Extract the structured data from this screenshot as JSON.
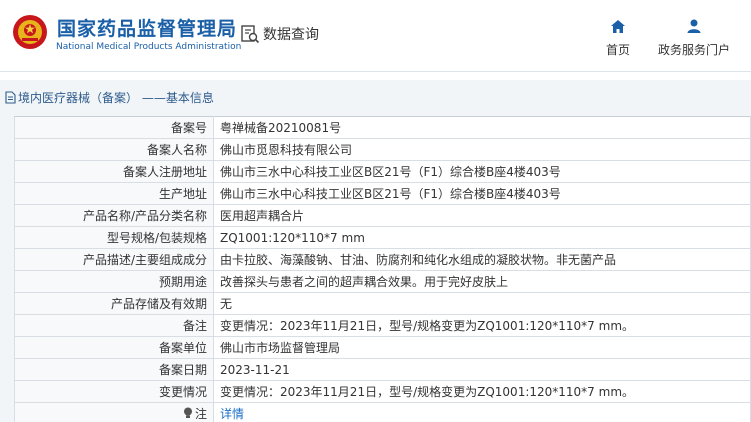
{
  "header": {
    "brand_cn": "国家药品监督管理局",
    "brand_en": "National Medical Products Administration",
    "query_label": "数据查询",
    "nav": [
      {
        "label": "首页",
        "icon": "home-icon"
      },
      {
        "label": "政务服务门户",
        "icon": "user-icon"
      }
    ]
  },
  "panel": {
    "breadcrumb": "境内医疗器械（备案） ——基本信息"
  },
  "record": {
    "rows": [
      {
        "key": "备案号",
        "value": "粤禅械备20210081号"
      },
      {
        "key": "备案人名称",
        "value": "佛山市觅恩科技有限公司"
      },
      {
        "key": "备案人注册地址",
        "value": "佛山市三水中心科技工业区B区21号（F1）综合楼B座4楼403号"
      },
      {
        "key": "生产地址",
        "value": "佛山市三水中心科技工业区B区21号（F1）综合楼B座4楼403号"
      },
      {
        "key": "产品名称/产品分类名称",
        "value": "医用超声耦合片"
      },
      {
        "key": "型号规格/包装规格",
        "value": "ZQ1001:120*110*7 mm"
      },
      {
        "key": "产品描述/主要组成成分",
        "value": "由卡拉胶、海藻酸钠、甘油、防腐剂和纯化水组成的凝胶状物。非无菌产品"
      },
      {
        "key": "预期用途",
        "value": "改善探头与患者之间的超声耦合效果。用于完好皮肤上"
      },
      {
        "key": "产品存储及有效期",
        "value": "无"
      },
      {
        "key": "备注",
        "value": "变更情况：2023年11月21日，型号/规格变更为ZQ1001:120*110*7 mm。"
      },
      {
        "key": "备案单位",
        "value": "佛山市市场监督管理局"
      },
      {
        "key": "备案日期",
        "value": "2023-11-21"
      },
      {
        "key": "变更情况",
        "value": "变更情况：2023年11月21日，型号/规格变更为ZQ1001:120*110*7 mm。"
      }
    ],
    "note": {
      "key": "注",
      "icon": "lightbulb-icon",
      "link": "详情"
    }
  },
  "colors": {
    "brand": "#1a5fa8",
    "link": "#1a6fc4",
    "panel_bg": "#f2f5f8"
  }
}
